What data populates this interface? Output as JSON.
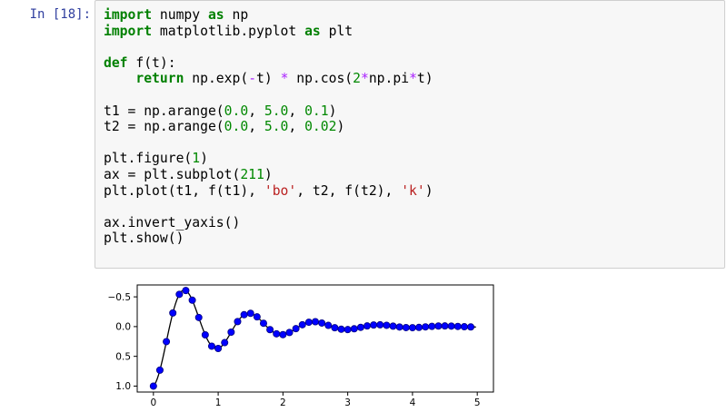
{
  "cell": {
    "prompt": "In [18]:",
    "code_lines": [
      [
        {
          "t": "import",
          "c": "k"
        },
        {
          "t": " numpy "
        },
        {
          "t": "as",
          "c": "k"
        },
        {
          "t": " np"
        }
      ],
      [
        {
          "t": "import",
          "c": "k"
        },
        {
          "t": " matplotlib.pyplot "
        },
        {
          "t": "as",
          "c": "k"
        },
        {
          "t": " plt"
        }
      ],
      [],
      [
        {
          "t": "def",
          "c": "k"
        },
        {
          "t": " f(t):"
        }
      ],
      [
        {
          "t": "    "
        },
        {
          "t": "return",
          "c": "k"
        },
        {
          "t": " np.exp("
        },
        {
          "t": "-",
          "c": "o"
        },
        {
          "t": "t) "
        },
        {
          "t": "*",
          "c": "o"
        },
        {
          "t": " np.cos("
        },
        {
          "t": "2",
          "c": "n"
        },
        {
          "t": "*",
          "c": "o"
        },
        {
          "t": "np.pi"
        },
        {
          "t": "*",
          "c": "o"
        },
        {
          "t": "t)"
        }
      ],
      [],
      [
        {
          "t": "t1 "
        },
        {
          "t": "="
        },
        {
          "t": " np.arange("
        },
        {
          "t": "0.0",
          "c": "n"
        },
        {
          "t": ", "
        },
        {
          "t": "5.0",
          "c": "n"
        },
        {
          "t": ", "
        },
        {
          "t": "0.1",
          "c": "n"
        },
        {
          "t": ")"
        }
      ],
      [
        {
          "t": "t2 "
        },
        {
          "t": "="
        },
        {
          "t": " np.arange("
        },
        {
          "t": "0.0",
          "c": "n"
        },
        {
          "t": ", "
        },
        {
          "t": "5.0",
          "c": "n"
        },
        {
          "t": ", "
        },
        {
          "t": "0.02",
          "c": "n"
        },
        {
          "t": ")"
        }
      ],
      [],
      [
        {
          "t": "plt.figure("
        },
        {
          "t": "1",
          "c": "n"
        },
        {
          "t": ")"
        }
      ],
      [
        {
          "t": "ax "
        },
        {
          "t": "="
        },
        {
          "t": " plt.subplot("
        },
        {
          "t": "211",
          "c": "n"
        },
        {
          "t": ")"
        }
      ],
      [
        {
          "t": "plt.plot(t1, f(t1), "
        },
        {
          "t": "'bo'",
          "c": "s"
        },
        {
          "t": ", t2, f(t2), "
        },
        {
          "t": "'k'",
          "c": "s"
        },
        {
          "t": ")"
        }
      ],
      [],
      [
        {
          "t": "ax.invert_yaxis()"
        }
      ],
      [
        {
          "t": "plt.show()"
        }
      ]
    ]
  },
  "chart_data": {
    "type": "line",
    "function": "exp(-t) * cos(2*pi*t)",
    "series": [
      {
        "style": "markers",
        "color": "#0000ff",
        "x_start": 0.0,
        "x_stop": 5.0,
        "x_step": 0.1
      },
      {
        "style": "line",
        "color": "#000000",
        "x_start": 0.0,
        "x_stop": 5.0,
        "x_step": 0.02
      }
    ],
    "xlim": [
      -0.25,
      5.25
    ],
    "ylim": [
      1.1,
      -0.7
    ],
    "y_inverted": true,
    "xticks": [
      0,
      1,
      2,
      3,
      4,
      5
    ],
    "yticks": [
      -0.5,
      0.0,
      0.5,
      1.0
    ],
    "xtick_labels": [
      "0",
      "1",
      "2",
      "3",
      "4",
      "5"
    ],
    "ytick_labels": [
      "−0.5",
      "0.0",
      "0.5",
      "1.0"
    ]
  }
}
